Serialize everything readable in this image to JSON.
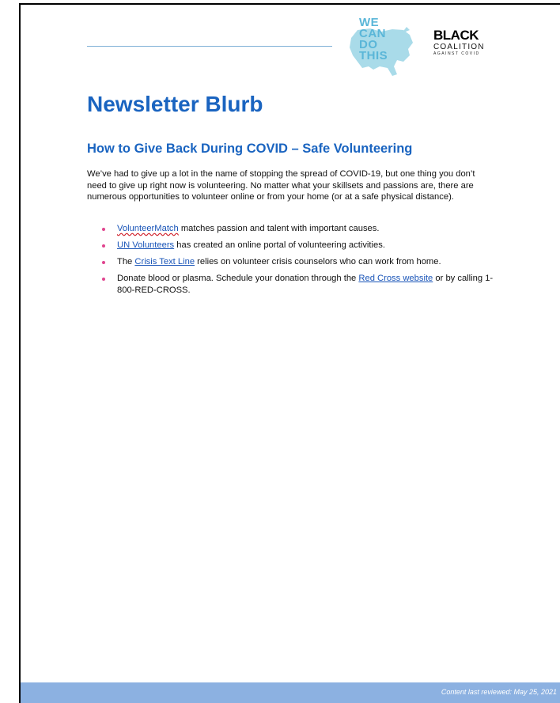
{
  "header": {
    "logo_left": {
      "lines": [
        "WE",
        "CAN",
        "DO",
        "THIS"
      ],
      "colors": {
        "text": "#5ab6d8",
        "map": "#a9dbe9"
      }
    },
    "logo_right": {
      "line1": "BLACK",
      "line2": "COALITION",
      "line3": "AGAINST COVID"
    }
  },
  "document": {
    "title": "Newsletter Blurb",
    "subtitle": "How to Give Back During COVID – Safe Volunteering",
    "body": "We’ve had to give up a lot in the name of stopping the spread of COVID-19, but one thing you don’t need to give up right now is volunteering. No matter what your skillsets and passions are, there are numerous opportunities to volunteer online or from your home (or at a safe physical distance).",
    "bullets": [
      {
        "prefix": "",
        "link": "VolunteerMatch",
        "suffix": " matches passion and talent with important causes."
      },
      {
        "prefix": "",
        "link": "UN Volunteers",
        "suffix": " has created an online portal of volunteering activities."
      },
      {
        "prefix": "The ",
        "link": "Crisis Text Line",
        "suffix": " relies on volunteer crisis counselors who can work from home."
      },
      {
        "prefix": "Donate blood or plasma. Schedule your donation through the ",
        "link": "Red Cross website",
        "suffix": " or by calling 1-800-RED-CROSS."
      }
    ]
  },
  "footer": {
    "text": "Content last reviewed: May 25, 2021"
  },
  "colors": {
    "heading": "#1a64c0",
    "link": "#1a55b8",
    "bullet": "#e0458f",
    "footer_bar": "#8cb1e1",
    "rule": "#7fb0d6"
  }
}
